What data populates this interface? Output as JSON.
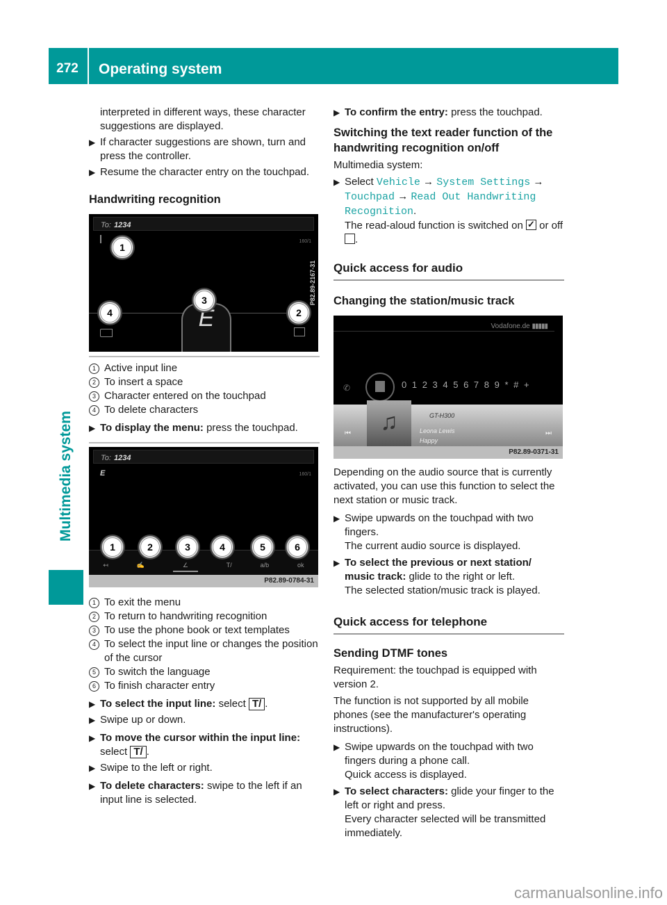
{
  "header": {
    "page_number": "272",
    "title": "Operating system"
  },
  "side_tab": {
    "label": "Multimedia system"
  },
  "left": {
    "intro_cont": "interpreted in different ways, these character suggestions are displayed.",
    "bullets1": [
      "If character suggestions are shown, turn and press the controller.",
      "Resume the character entry on the touchpad."
    ],
    "heading_handwriting": "Handwriting recognition",
    "fig1": {
      "to_label": "To:",
      "to_value": "1234",
      "counter": "160/1",
      "char": "E",
      "code": "P82.89-2167-31",
      "callouts": [
        "1",
        "2",
        "3",
        "4"
      ]
    },
    "legend1": [
      {
        "num": "1",
        "text": "Active input line"
      },
      {
        "num": "2",
        "text": "To insert a space"
      },
      {
        "num": "3",
        "text": "Character entered on the touchpad"
      },
      {
        "num": "4",
        "text": "To delete characters"
      }
    ],
    "display_menu": {
      "bold": "To display the menu:",
      "text": " press the touchpad."
    },
    "fig2": {
      "to_label": "To:",
      "to_value": "1234",
      "input_char": "E",
      "counter": "160/1",
      "callouts": [
        "1",
        "2",
        "3",
        "4",
        "5",
        "6"
      ],
      "menu_icons": [
        "↤",
        "✍",
        "∠",
        "T/",
        "a/b",
        "ok"
      ],
      "code": "P82.89-0784-31"
    },
    "legend2": [
      {
        "num": "1",
        "text": "To exit the menu"
      },
      {
        "num": "2",
        "text": "To return to handwriting recognition"
      },
      {
        "num": "3",
        "text": "To use the phone book or text templates"
      },
      {
        "num": "4",
        "text": "To select the input line or changes the position of the cursor"
      },
      {
        "num": "5",
        "text": "To switch the language"
      },
      {
        "num": "6",
        "text": "To finish character entry"
      }
    ],
    "select_input": {
      "bold": "To select the input line:",
      "text": " select ",
      "key": "T/",
      "end": "."
    },
    "swipe_updown": "Swipe up or down.",
    "move_cursor": {
      "bold": "To move the cursor within the input line:",
      "text": "select ",
      "key": "T/",
      "end": "."
    },
    "swipe_lr": "Swipe to the left or right.",
    "delete_chars": {
      "bold": "To delete characters:",
      "text": " swipe to the left if an input line is selected."
    }
  },
  "right": {
    "confirm": {
      "bold": "To confirm the entry:",
      "text": " press the touchpad."
    },
    "heading_reader": "Switching the text reader function of the handwriting recognition on/off",
    "multimedia_system": "Multimedia system:",
    "select_path": {
      "prefix": "Select ",
      "items": [
        "Vehicle",
        "System Settings",
        "Touchpad",
        "Read Out Handwriting Recognition"
      ],
      "arrow": "→",
      "end": "."
    },
    "readaloud_text": "The read-aloud function is switched on",
    "or_off": "or off",
    "heading_audio": "Quick access for audio",
    "heading_station": "Changing the station/music track",
    "fig3": {
      "network": "Vodafone.de",
      "digits": [
        "0",
        "1",
        "2",
        "3",
        "4",
        "5",
        "6",
        "7",
        "8",
        "9",
        "*",
        "#",
        "+"
      ],
      "station": "GT-H300",
      "artist": "Leona Lewis",
      "track": "Happy",
      "code": "P82.89-0371-31"
    },
    "audio_desc": "Depending on the audio source that is currently activated, you can use this function to select the next station or music track.",
    "swipe_audio": {
      "text": "Swipe upwards on the touchpad with two fingers.",
      "result": "The current audio source is displayed."
    },
    "select_station": {
      "bold": "To select the previous or next station/ music track:",
      "text": " glide to the right or left.",
      "result": "The selected station/music track is played."
    },
    "heading_telephone": "Quick access for telephone",
    "heading_dtmf": "Sending DTMF tones",
    "requirement": "Requirement: the touchpad is equipped with version 2.",
    "not_supported": "The function is not supported by all mobile phones (see the manufacturer's operating instructions).",
    "swipe_phone": {
      "text": "Swipe upwards on the touchpad with two fingers during a phone call.",
      "result": "Quick access is displayed."
    },
    "select_chars": {
      "bold": "To select characters:",
      "text": " glide your finger to the left or right and press.",
      "result": "Every character selected will be transmitted immediately."
    }
  },
  "watermark": "carmanualsonline.info",
  "colors": {
    "accent": "#009999",
    "link": "#1aa3a3"
  }
}
